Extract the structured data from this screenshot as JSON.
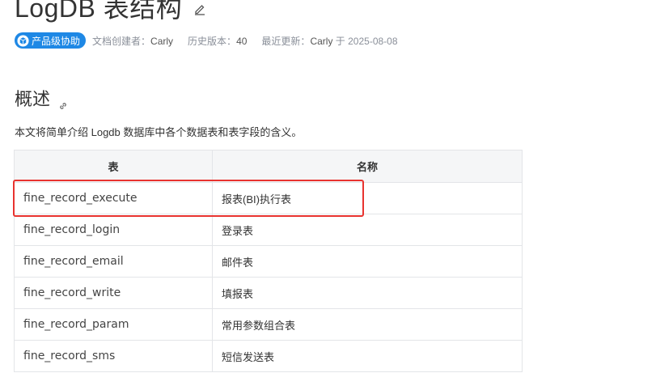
{
  "header": {
    "title": "LogDB 表结构"
  },
  "meta": {
    "badge_label": "产品级协助",
    "creator_label": "文档创建者：",
    "creator_value": "Carly",
    "history_label": "历史版本：",
    "history_value": "40",
    "updated_label": "最近更新：",
    "updated_user": "Carly",
    "updated_at": "于 2025-08-08"
  },
  "section": {
    "title": "概述",
    "intro": "本文将简单介绍 Logdb 数据库中各个数据表和表字段的含义。"
  },
  "table": {
    "headers": [
      "表",
      "名称"
    ],
    "rows": [
      [
        "fine_record_execute",
        "报表(BI)执行表"
      ],
      [
        "fine_record_login",
        "登录表"
      ],
      [
        "fine_record_email",
        "邮件表"
      ],
      [
        "fine_record_write",
        "填报表"
      ],
      [
        "fine_record_param",
        "常用参数组合表"
      ],
      [
        "fine_record_sms",
        "短信发送表"
      ]
    ]
  },
  "colors": {
    "badge": "#1e88e5",
    "highlight": "#e8332f",
    "header_bg": "#f5f6f7"
  }
}
